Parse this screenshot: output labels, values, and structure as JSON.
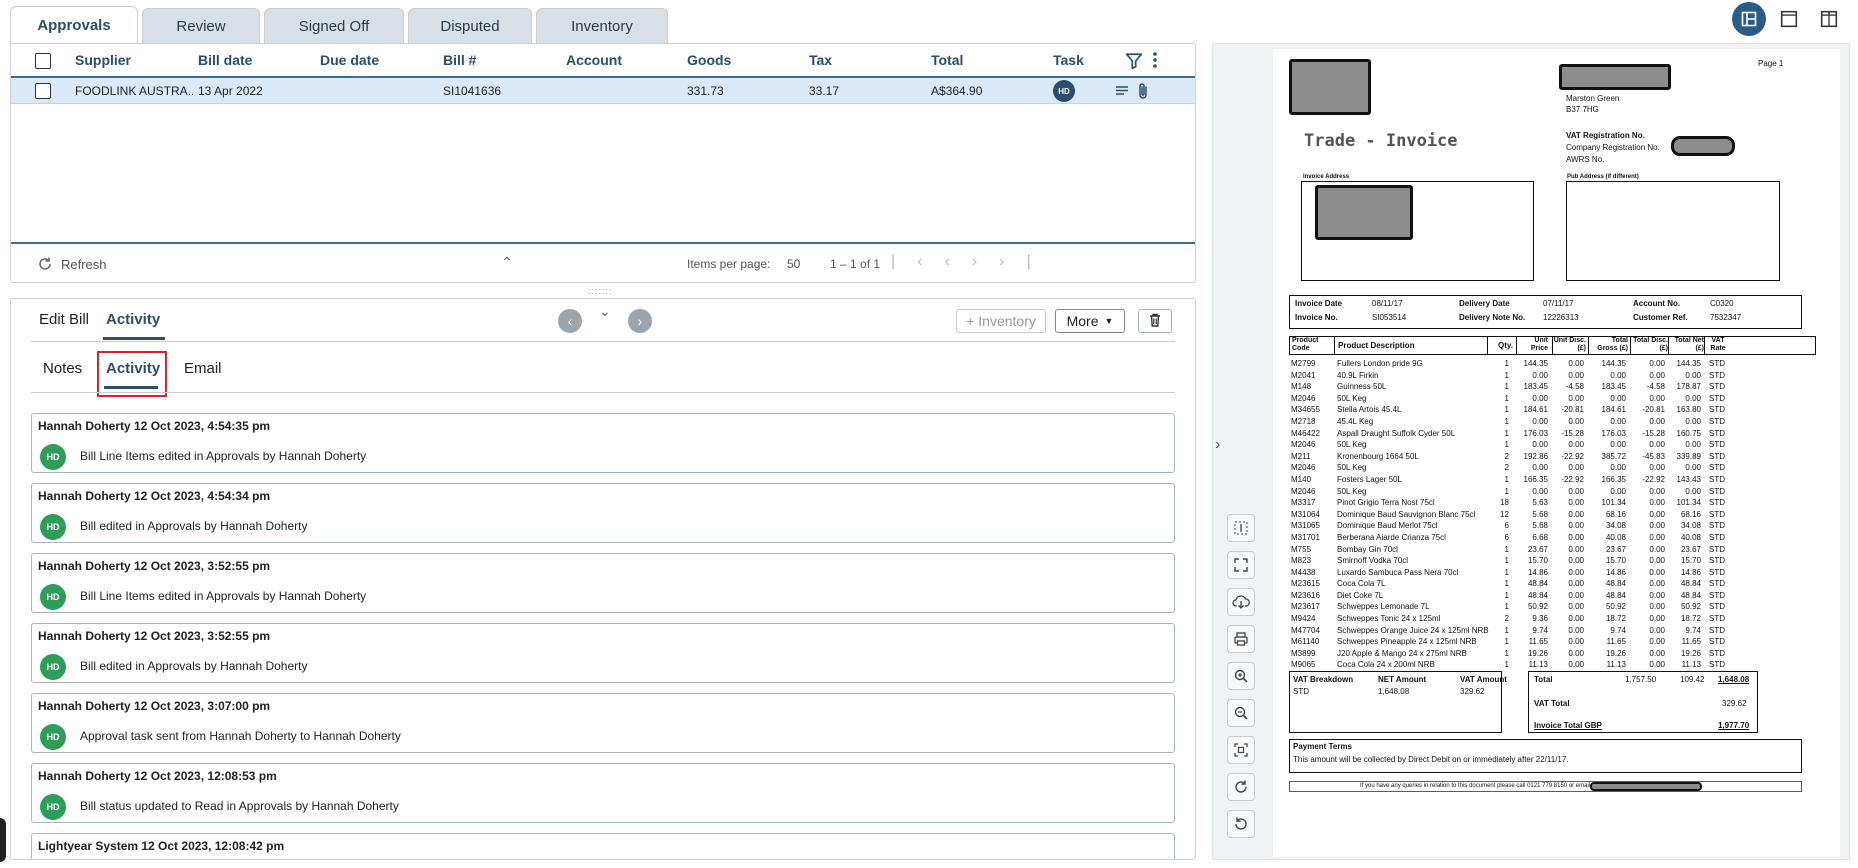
{
  "top_tabs": [
    "Approvals",
    "Review",
    "Signed Off",
    "Disputed",
    "Inventory"
  ],
  "grid": {
    "columns": [
      "Supplier",
      "Bill date",
      "Due date",
      "Bill #",
      "Account",
      "Goods",
      "Tax",
      "Total",
      "Task"
    ],
    "row": {
      "supplier": "FOODLINK AUSTRA...",
      "bill_date": "13 Apr 2022",
      "due_date": "",
      "bill_no": "SI1041636",
      "account": "",
      "goods": "331.73",
      "tax": "33.17",
      "total": "A$364.90",
      "task_avatar": "HD"
    },
    "footer": {
      "refresh_label": "Refresh",
      "items_per_page_label": "Items per page:",
      "items_per_page": "50",
      "range": "1 – 1 of 1"
    }
  },
  "lower": {
    "tabs": [
      "Edit Bill",
      "Activity"
    ],
    "inventory_button": "Inventory",
    "more_button": "More",
    "sub_tabs": [
      "Notes",
      "Activity",
      "Email"
    ],
    "activity": [
      {
        "title": "Hannah Doherty 12 Oct 2023, 4:54:35 pm",
        "avatar": "HD",
        "message": "Bill Line Items edited in Approvals by Hannah Doherty"
      },
      {
        "title": "Hannah Doherty 12 Oct 2023, 4:54:34 pm",
        "avatar": "HD",
        "message": "Bill edited in Approvals by Hannah Doherty"
      },
      {
        "title": "Hannah Doherty 12 Oct 2023, 3:52:55 pm",
        "avatar": "HD",
        "message": "Bill Line Items edited in Approvals by Hannah Doherty"
      },
      {
        "title": "Hannah Doherty 12 Oct 2023, 3:52:55 pm",
        "avatar": "HD",
        "message": "Bill edited in Approvals by Hannah Doherty"
      },
      {
        "title": "Hannah Doherty 12 Oct 2023, 3:07:00 pm",
        "avatar": "HD",
        "message": "Approval task sent from Hannah Doherty to Hannah Doherty"
      },
      {
        "title": "Hannah Doherty 12 Oct 2023, 12:08:53 pm",
        "avatar": "HD",
        "message": "Bill status updated to Read in Approvals by Hannah Doherty"
      },
      {
        "title": "Lightyear System 12 Oct 2023, 12:08:42 pm",
        "avatar": "",
        "message": ""
      }
    ]
  },
  "invoice": {
    "page_label": "Page 1",
    "title": "Trade - Invoice",
    "address_lines": [
      "Marston Green",
      "B37 7HG"
    ],
    "reg_lines": [
      "VAT Registration No.",
      "Company Registration No.",
      "AWRS No."
    ],
    "invoice_address_label": "Invoice Address",
    "pub_address_label": "Pub Address (if different)",
    "meta": {
      "invoice_date_label": "Invoice Date",
      "invoice_date": "08/11/17",
      "invoice_no_label": "Invoice No.",
      "invoice_no": "SI053514",
      "delivery_date_label": "Delivery Date",
      "delivery_date": "07/11/17",
      "delivery_note_label": "Delivery Note No.",
      "delivery_note": "12226313",
      "account_label": "Account No.",
      "account": "C0320",
      "customer_ref_label": "Customer Ref.",
      "customer_ref": "7532347"
    },
    "headers": [
      "Product Code",
      "Product Description",
      "Qty.",
      "Unit Price",
      "Unit Disc. (£)",
      "Total Gross (£)",
      "Total Disc. (£)",
      "Total Net (£)",
      "VAT Rate"
    ],
    "items": [
      [
        "M2799",
        "Fullers London pride 9G",
        "1",
        "144.35",
        "0.00",
        "144.35",
        "0.00",
        "144.35",
        "STD"
      ],
      [
        "M2041",
        "40.9L Firkin",
        "1",
        "0.00",
        "0.00",
        "0.00",
        "0.00",
        "0.00",
        "STD"
      ],
      [
        "M148",
        "Guinness  50L",
        "1",
        "183.45",
        "-4.58",
        "183.45",
        "-4.58",
        "178.87",
        "STD"
      ],
      [
        "M2046",
        "50L Keg",
        "1",
        "0.00",
        "0.00",
        "0.00",
        "0.00",
        "0.00",
        "STD"
      ],
      [
        "M34655",
        "Stella Artois  45.4L",
        "1",
        "184.61",
        "-20.81",
        "184.61",
        "-20.81",
        "163.80",
        "STD"
      ],
      [
        "M2718",
        "45.4L Keg",
        "1",
        "0.00",
        "0.00",
        "0.00",
        "0.00",
        "0.00",
        "STD"
      ],
      [
        "M46422",
        "Aspall Draught Suffolk Cyder 50L",
        "1",
        "176.03",
        "-15.28",
        "176.03",
        "-15.28",
        "160.75",
        "STD"
      ],
      [
        "M2046",
        "50L Keg",
        "1",
        "0.00",
        "0.00",
        "0.00",
        "0.00",
        "0.00",
        "STD"
      ],
      [
        "M211",
        "Kronenbourg 1664  50L",
        "2",
        "192.86",
        "-22.92",
        "385.72",
        "-45.83",
        "339.89",
        "STD"
      ],
      [
        "M2046",
        "50L Keg",
        "2",
        "0.00",
        "0.00",
        "0.00",
        "0.00",
        "0.00",
        "STD"
      ],
      [
        "M140",
        "Fosters Lager  50L",
        "1",
        "166.35",
        "-22.92",
        "166.35",
        "-22.92",
        "143.43",
        "STD"
      ],
      [
        "M2046",
        "50L Keg",
        "1",
        "0.00",
        "0.00",
        "0.00",
        "0.00",
        "0.00",
        "STD"
      ],
      [
        "M3317",
        "Pinot Grigio Terra Nost  75cl",
        "18",
        "5.63",
        "0.00",
        "101.34",
        "0.00",
        "101.34",
        "STD"
      ],
      [
        "M31064",
        "Dominique Baud Sauvignon Blanc  75cl",
        "12",
        "5.68",
        "0.00",
        "68.16",
        "0.00",
        "68.16",
        "STD"
      ],
      [
        "M31065",
        "Dominique Baud Merlot  75cl",
        "6",
        "5.68",
        "0.00",
        "34.08",
        "0.00",
        "34.08",
        "STD"
      ],
      [
        "M31701",
        "Berberana Aiarde Crianza  75cl",
        "6",
        "6.68",
        "0.00",
        "40.08",
        "0.00",
        "40.08",
        "STD"
      ],
      [
        "M755",
        "Bombay Gin  70cl",
        "1",
        "23.67",
        "0.00",
        "23.67",
        "0.00",
        "23.67",
        "STD"
      ],
      [
        "M823",
        "Smirnoff Vodka  70cl",
        "1",
        "15.70",
        "0.00",
        "15.70",
        "0.00",
        "15.70",
        "STD"
      ],
      [
        "M4438",
        "Luxardo Sambuca Pass Nera  70cl",
        "1",
        "14.86",
        "0.00",
        "14.86",
        "0.00",
        "14.86",
        "STD"
      ],
      [
        "M23615",
        "Coca Cola  7L",
        "1",
        "48.84",
        "0.00",
        "48.84",
        "0.00",
        "48.84",
        "STD"
      ],
      [
        "M23616",
        "Diet Coke  7L",
        "1",
        "48.84",
        "0.00",
        "48.84",
        "0.00",
        "48.84",
        "STD"
      ],
      [
        "M23617",
        "Schweppes Lemonade  7L",
        "1",
        "50.92",
        "0.00",
        "50.92",
        "0.00",
        "50.92",
        "STD"
      ],
      [
        "M9424",
        "Schweppes Tonic 24 x 125ml",
        "2",
        "9.36",
        "0.00",
        "18.72",
        "0.00",
        "18.72",
        "STD"
      ],
      [
        "M47704",
        "Schweppes Orange Juice  24 x 125ml NRB",
        "1",
        "9.74",
        "0.00",
        "9.74",
        "0.00",
        "9.74",
        "STD"
      ],
      [
        "M61140",
        "Schweppes Pineapple  24 x 125ml NRB",
        "1",
        "11.65",
        "0.00",
        "11.65",
        "0.00",
        "11.65",
        "STD"
      ],
      [
        "M3899",
        "J20 Apple & Mango  24 x 275ml NRB",
        "1",
        "19.26",
        "0.00",
        "19.26",
        "0.00",
        "19.26",
        "STD"
      ],
      [
        "M9065",
        "Coca Cola  24 x 200ml NRB",
        "1",
        "11.13",
        "0.00",
        "11.13",
        "0.00",
        "11.13",
        "STD"
      ]
    ],
    "vat": {
      "breakdown_label": "VAT Breakdown",
      "net_label": "NET Amount",
      "vat_label": "VAT Amount",
      "code": "STD",
      "net": "1,648.08",
      "amount": "329.62"
    },
    "totals": {
      "total_label": "Total",
      "total_gross": "1,757.50",
      "total_disc": "109.42",
      "total_net": "1,648.08",
      "vat_total_label": "VAT Total",
      "vat_total": "329.62",
      "invoice_total_label": "Invoice Total GBP",
      "invoice_total": "1,977.70"
    },
    "payment_terms_label": "Payment Terms",
    "payment_terms": "This amount will be collected by Direct Debit  on or immediately after 22/11/17.",
    "footer_note": "If you have any queries in relation to this document please call 0121 779 8150 or email"
  }
}
